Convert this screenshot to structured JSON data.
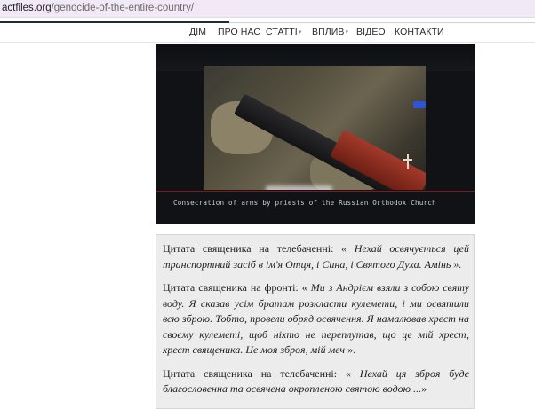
{
  "browser": {
    "url_domain": "actfiles.org",
    "url_path": "/genocide-of-the-entire-country/"
  },
  "nav": {
    "items": [
      {
        "label": "ДІМ"
      },
      {
        "label": "ПРО НАС"
      },
      {
        "label": "СТАТТІ"
      },
      {
        "label": "ВПЛИВ"
      },
      {
        "label": "ВІДЕО"
      },
      {
        "label": "КОНТАКТИ"
      }
    ],
    "caret": "▾"
  },
  "hero": {
    "caption": "Consecration of arms by priests of the Russian Orthodox Church",
    "colors": {
      "flag_red": "#c4242a",
      "flag_blue": "#2d55d8",
      "stock_wood": "#a33a2a"
    }
  },
  "quotes": [
    {
      "lead": "Цитата священика на телебаченні: ",
      "text": "« Нехай освячується цей транспортний засіб в ім'я Отця, і Сина, і Святого Духа. Амінь ».",
      "after": ""
    },
    {
      "lead": "Цитата священика на фронті: « ",
      "text": "Ми з Андрієм взяли з собою святу воду. Я сказав усім братам розкласти кулемети, і ми освятили всю зброю. Тобто, провели обряд освячення. Я намалював хрест на своєму кулеметі, щоб ніхто не переплутав, що це мій хрест, хрест священика. Це моя зброя, мій меч",
      "after": " »."
    },
    {
      "lead": "Цитата священика на телебаченні: « ",
      "text": "Нехай ця зброя буде благословенна та освячена окропленою святою водою ...",
      "after": "»"
    }
  ]
}
